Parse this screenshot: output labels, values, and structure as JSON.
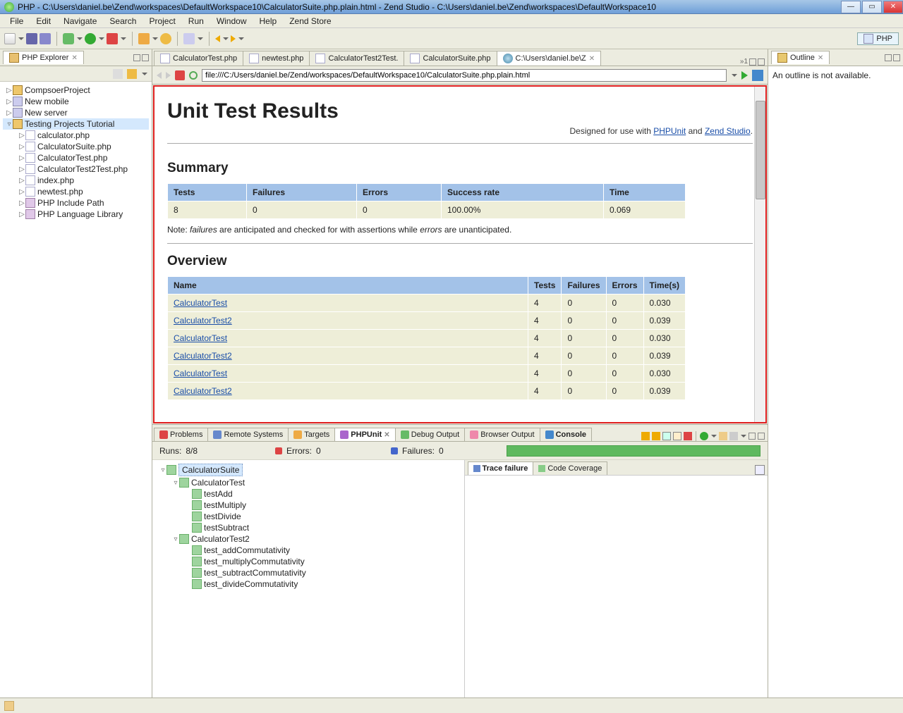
{
  "title": "PHP - C:\\Users\\daniel.be\\Zend\\workspaces\\DefaultWorkspace10\\CalculatorSuite.php.plain.html - Zend Studio - C:\\Users\\daniel.be\\Zend\\workspaces\\DefaultWorkspace10",
  "menu": [
    "File",
    "Edit",
    "Navigate",
    "Search",
    "Project",
    "Run",
    "Window",
    "Help",
    "Zend Store"
  ],
  "perspective": "PHP",
  "left": {
    "tab": "PHP Explorer",
    "tree": [
      {
        "d": 0,
        "tw": "▷",
        "icon": "folder",
        "label": "CompsoerProject"
      },
      {
        "d": 0,
        "tw": "▷",
        "icon": "server",
        "label": "New mobile"
      },
      {
        "d": 0,
        "tw": "▷",
        "icon": "server",
        "label": "New server"
      },
      {
        "d": 0,
        "tw": "▿",
        "icon": "folder",
        "label": "Testing Projects Tutorial",
        "sel": true
      },
      {
        "d": 1,
        "tw": "▷",
        "icon": "file",
        "label": "calculator.php"
      },
      {
        "d": 1,
        "tw": "▷",
        "icon": "file",
        "label": "CalculatorSuite.php"
      },
      {
        "d": 1,
        "tw": "▷",
        "icon": "file",
        "label": "CalculatorTest.php"
      },
      {
        "d": 1,
        "tw": "▷",
        "icon": "file",
        "label": "CalculatorTest2Test.php"
      },
      {
        "d": 1,
        "tw": "▷",
        "icon": "file",
        "label": "index.php"
      },
      {
        "d": 1,
        "tw": "▷",
        "icon": "file",
        "label": "newtest.php"
      },
      {
        "d": 1,
        "tw": "▷",
        "icon": "lib",
        "label": "PHP Include Path"
      },
      {
        "d": 1,
        "tw": "▷",
        "icon": "lib",
        "label": "PHP Language Library"
      }
    ]
  },
  "editor": {
    "tabs": [
      {
        "label": "CalculatorTest.php",
        "icon": "php"
      },
      {
        "label": "newtest.php",
        "icon": "php"
      },
      {
        "label": "CalculatorTest2Test.",
        "icon": "php"
      },
      {
        "label": "CalculatorSuite.php",
        "icon": "php"
      },
      {
        "label": "C:\\Users\\daniel.be\\Z",
        "icon": "globe",
        "active": true,
        "closeable": true
      }
    ],
    "overflow": "1",
    "url": "file:///C:/Users/daniel.be/Zend/workspaces/DefaultWorkspace10/CalculatorSuite.php.plain.html"
  },
  "report": {
    "h1": "Unit Test Results",
    "designed_prefix": "Designed for use with ",
    "link1": "PHPUnit",
    "and": " and ",
    "link2": "Zend Studio",
    "period": ".",
    "summary_h": "Summary",
    "summary_cols": [
      "Tests",
      "Failures",
      "Errors",
      "Success rate",
      "Time"
    ],
    "summary_row": [
      "8",
      "0",
      "0",
      "100.00%",
      "0.069"
    ],
    "note_prefix": "Note: ",
    "note_failures": "failures",
    "note_mid": " are anticipated and checked for with assertions while ",
    "note_errors": "errors",
    "note_suffix": " are unanticipated.",
    "overview_h": "Overview",
    "overview_cols": [
      "Name",
      "Tests",
      "Failures",
      "Errors",
      "Time(s)"
    ],
    "overview_rows": [
      {
        "name": "CalculatorTest",
        "t": "4",
        "f": "0",
        "e": "0",
        "time": "0.030"
      },
      {
        "name": "CalculatorTest2",
        "t": "4",
        "f": "0",
        "e": "0",
        "time": "0.039"
      },
      {
        "name": "CalculatorTest",
        "t": "4",
        "f": "0",
        "e": "0",
        "time": "0.030"
      },
      {
        "name": "CalculatorTest2",
        "t": "4",
        "f": "0",
        "e": "0",
        "time": "0.039"
      },
      {
        "name": "CalculatorTest",
        "t": "4",
        "f": "0",
        "e": "0",
        "time": "0.030"
      },
      {
        "name": "CalculatorTest2",
        "t": "4",
        "f": "0",
        "e": "0",
        "time": "0.039"
      }
    ]
  },
  "right": {
    "tab": "Outline",
    "msg": "An outline is not available."
  },
  "bottom": {
    "tabs": [
      "Problems",
      "Remote Systems",
      "Targets",
      "PHPUnit",
      "Debug Output",
      "Browser Output",
      "Console"
    ],
    "active_idx": 3,
    "bold_idxs": [
      6
    ],
    "runs_label": "Runs:",
    "runs_val": "8/8",
    "errors_label": "Errors:",
    "errors_val": "0",
    "failures_label": "Failures:",
    "failures_val": "0",
    "tree": [
      {
        "d": 0,
        "tw": "▿",
        "label": "CalculatorSuite",
        "suite": true,
        "sel": true
      },
      {
        "d": 1,
        "tw": "▿",
        "label": "CalculatorTest",
        "suite": true
      },
      {
        "d": 2,
        "tw": "",
        "label": "testAdd"
      },
      {
        "d": 2,
        "tw": "",
        "label": "testMultiply"
      },
      {
        "d": 2,
        "tw": "",
        "label": "testDivide"
      },
      {
        "d": 2,
        "tw": "",
        "label": "testSubtract"
      },
      {
        "d": 1,
        "tw": "▿",
        "label": "CalculatorTest2",
        "suite": true
      },
      {
        "d": 2,
        "tw": "",
        "label": "test_addCommutativity"
      },
      {
        "d": 2,
        "tw": "",
        "label": "test_multiplyCommutativity"
      },
      {
        "d": 2,
        "tw": "",
        "label": "test_subtractCommutativity"
      },
      {
        "d": 2,
        "tw": "",
        "label": "test_divideCommutativity"
      }
    ],
    "trace_tabs": [
      "Trace failure",
      "Code Coverage"
    ]
  }
}
